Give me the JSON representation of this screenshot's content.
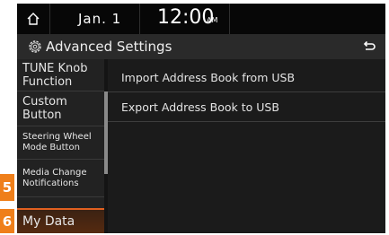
{
  "status": {
    "date": "Jan. 1",
    "time": "12:00",
    "ampm": "AM"
  },
  "header": {
    "title": "Advanced Settings"
  },
  "sidebar": {
    "items": [
      {
        "label": "TUNE Knob Function"
      },
      {
        "label": "Custom Button"
      },
      {
        "label": "Steering Wheel Mode Button"
      },
      {
        "label": "Media Change Notifications"
      },
      {
        "label": "My Data"
      }
    ]
  },
  "main": {
    "items": [
      {
        "label": "Import Address Book from USB"
      },
      {
        "label": "Export Address Book to USB"
      }
    ]
  },
  "callouts": [
    "5",
    "6"
  ],
  "colors": {
    "accent": "#e06020",
    "callout": "#ef7f1a",
    "background": "#1b1b1b"
  }
}
